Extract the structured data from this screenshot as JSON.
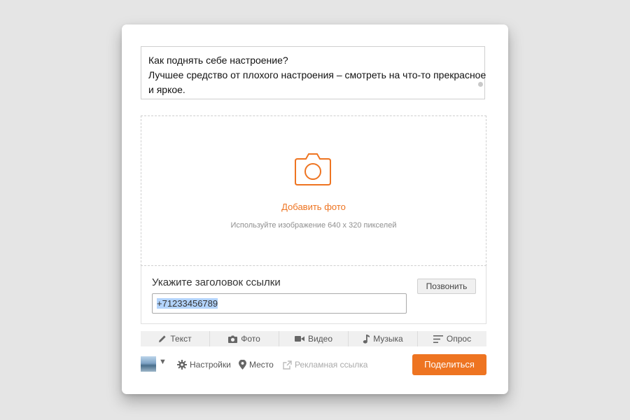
{
  "post_text": {
    "lines": [
      "Как поднять себе настроение?",
      "Лучшее средство от плохого настроения – смотреть на что-то прекрасное",
      "и яркое."
    ]
  },
  "upload": {
    "icon": "camera-icon",
    "add_photo_label": "Добавить фото",
    "hint": "Используйте изображение 640 x 320 пикселей"
  },
  "link": {
    "title": "Укажите заголовок ссылки",
    "input_value": "+71233456789",
    "call_button_label": "Позвонить"
  },
  "tabs": [
    {
      "label": "Текст",
      "icon": "pencil-icon"
    },
    {
      "label": "Фото",
      "icon": "camera-icon"
    },
    {
      "label": "Видео",
      "icon": "video-icon"
    },
    {
      "label": "Музыка",
      "icon": "music-note-icon"
    },
    {
      "label": "Опрос",
      "icon": "poll-icon"
    }
  ],
  "footer": {
    "settings_label": "Настройки",
    "place_label": "Место",
    "ad_link_label": "Рекламная ссылка",
    "share_label": "Поделиться"
  },
  "colors": {
    "accent": "#ee7421",
    "background": "#e5e5e5"
  }
}
